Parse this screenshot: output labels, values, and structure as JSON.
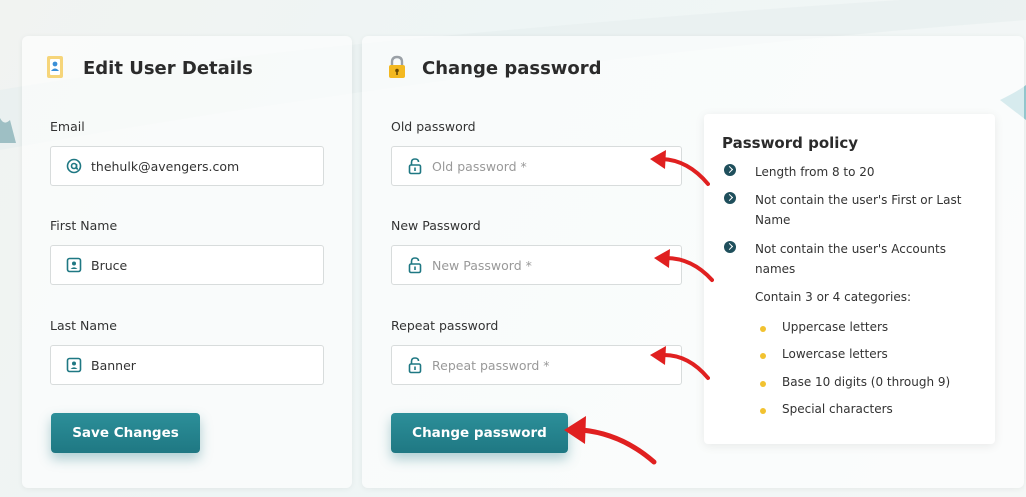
{
  "edit_user": {
    "title": "Edit User Details",
    "email_label": "Email",
    "email_value": "thehulk@avengers.com",
    "first_name_label": "First Name",
    "first_name_value": "Bruce",
    "last_name_label": "Last Name",
    "last_name_value": "Banner",
    "save_button": "Save Changes"
  },
  "change_password": {
    "title": "Change password",
    "old_label": "Old password",
    "old_placeholder": "Old password *",
    "new_label": "New Password",
    "new_placeholder": "New Password *",
    "repeat_label": "Repeat password",
    "repeat_placeholder": "Repeat password *",
    "button": "Change password"
  },
  "policy": {
    "title": "Password policy",
    "rules": [
      "Length from 8 to 20",
      "Not contain the user's First or Last Name",
      "Not contain the user's Accounts names"
    ],
    "categories_heading": "Contain 3 or 4 categories:",
    "categories": [
      "Uppercase letters",
      "Lowercase letters",
      "Base 10 digits (0 through 9)",
      "Special characters"
    ]
  },
  "colors": {
    "accent": "#1f7883",
    "rule_bullet": "#1f4f5c",
    "category_bullet": "#f2c230",
    "annotation_arrow": "#e02020"
  },
  "icons": {
    "edit_user": "user-card-icon",
    "change_password": "padlock-icon",
    "email": "at-icon",
    "name": "person-badge-icon",
    "password": "unlock-icon",
    "rule": "chevron-circle-icon",
    "annotation": "curved-arrow-icon"
  }
}
